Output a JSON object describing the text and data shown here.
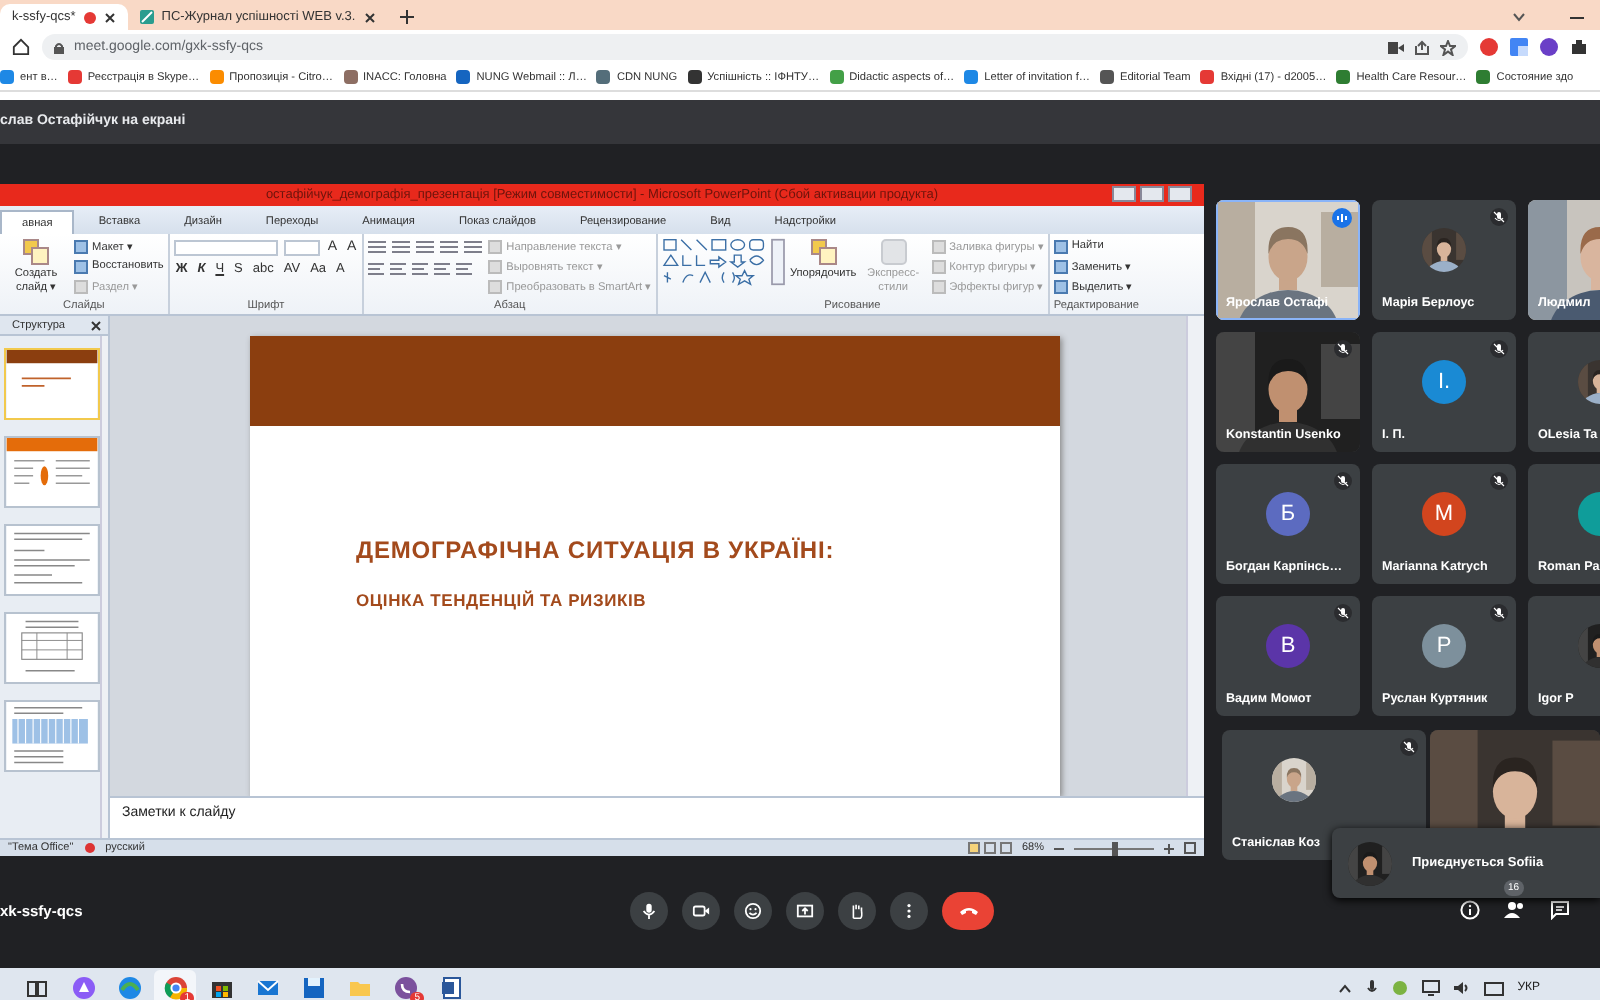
{
  "browser": {
    "tabs": [
      {
        "title": "k-ssfy-qcs*",
        "selected": true,
        "recording": true
      },
      {
        "title": "ПС-Журнал успішності WEB v.3.",
        "selected": false,
        "recording": false
      }
    ],
    "url": "meet.google.com/gxk-ssfy-qcs",
    "bookmarks": [
      "ент в…",
      "Реєстрація в Skype…",
      "Пропозиція - Citro…",
      "INACC: Головна",
      "NUNG Webmail :: Л…",
      "CDN NUNG",
      "Успішність :: ІФНТУ…",
      "Didactic aspects of…",
      "Letter of invitation f…",
      "Editorial Team",
      "Вхідні (17) - d2005…",
      "Health Care Resour…",
      "Состояние здо"
    ]
  },
  "meet": {
    "banner": "слав Остафійчук на екрані",
    "powerpoint": {
      "title": "остафійчук_демографія_презентація [Режим совместимости] - Microsoft PowerPoint (Сбой активации продукта)",
      "tabs": [
        {
          "label": "авная",
          "selected": true
        },
        {
          "label": "Вставка",
          "selected": false
        },
        {
          "label": "Дизайн",
          "selected": false
        },
        {
          "label": "Переходы",
          "selected": false
        },
        {
          "label": "Анимация",
          "selected": false
        },
        {
          "label": "Показ слайдов",
          "selected": false
        },
        {
          "label": "Рецензирование",
          "selected": false
        },
        {
          "label": "Вид",
          "selected": false
        },
        {
          "label": "Надстройки",
          "selected": false
        }
      ],
      "ribbon": [
        {
          "label": "Слайды",
          "items": [
            {
              "kind": "large",
              "label": "Создать слайд ▾",
              "disabled": false
            },
            {
              "kind": "small",
              "label": "Макет ▾",
              "disabled": false
            },
            {
              "kind": "small",
              "label": "Восстановить",
              "disabled": false
            },
            {
              "kind": "small",
              "label": "Раздел ▾",
              "disabled": true
            }
          ]
        },
        {
          "label": "Шрифт",
          "items": [
            {
              "kind": "font-tools",
              "glyphs_top": [
                "A",
                "A"
              ],
              "glyphs": [
                "Ж",
                "К",
                "Ч",
                "S",
                "abc",
                "AV",
                "Aa",
                "A"
              ]
            }
          ]
        },
        {
          "label": "Абзац",
          "items": [
            {
              "kind": "paragraph-tools"
            },
            {
              "kind": "small",
              "label": "Направление текста ▾",
              "disabled": true
            },
            {
              "kind": "small",
              "label": "Выровнять текст ▾",
              "disabled": true
            },
            {
              "kind": "small",
              "label": "Преобразовать в SmartArt ▾",
              "disabled": true
            }
          ]
        },
        {
          "label": "Рисование",
          "items": [
            {
              "kind": "shapes"
            },
            {
              "kind": "large",
              "label": "Упорядочить",
              "disabled": false
            },
            {
              "kind": "large",
              "label": "Экспресс-стили",
              "disabled": true
            },
            {
              "kind": "small",
              "label": "Заливка фигуры ▾",
              "disabled": true
            },
            {
              "kind": "small",
              "label": "Контур фигуры ▾",
              "disabled": true
            },
            {
              "kind": "small",
              "label": "Эффекты фигур ▾",
              "disabled": true
            }
          ]
        },
        {
          "label": "Редактирование",
          "items": [
            {
              "kind": "small",
              "label": "Найти",
              "disabled": false
            },
            {
              "kind": "small",
              "label": "Заменить ▾",
              "disabled": false
            },
            {
              "kind": "small",
              "label": "Выделить ▾",
              "disabled": false
            }
          ]
        }
      ],
      "outline_tab": "Структура",
      "thumbnails": [
        {
          "kind": "title",
          "selected": true
        },
        {
          "kind": "bullets",
          "selected": false
        },
        {
          "kind": "text",
          "selected": false
        },
        {
          "kind": "table",
          "selected": false
        },
        {
          "kind": "chart",
          "selected": false
        }
      ],
      "slide": {
        "title": "ДЕМОГРАФІЧНА СИТУАЦІЯ В УКРАЇНІ:",
        "subtitle": "ОЦІНКА ТЕНДЕНЦІЙ ТА РИЗИКІВ"
      },
      "notes": {
        "placeholder": "Заметки к слайду"
      },
      "status": {
        "theme": "\"Тема Office\"",
        "language": "русский",
        "zoom": "68%",
        "level": 0.5
      }
    },
    "participants": [
      {
        "name": "Ярослав Остафі",
        "kind": "video",
        "speaking": true,
        "muted": false
      },
      {
        "name": "Марія Берлоус",
        "speaking": false,
        "muted": true
      },
      {
        "name": "Людмил",
        "kind": "video",
        "speaking": false
      },
      {
        "name": "Konstantin Usenko",
        "kind": "video",
        "speaking": false,
        "muted": true
      },
      {
        "name": "І. П.",
        "kind": "letter",
        "initial": "І.",
        "color": "#1a8ad4",
        "speaking": false,
        "muted": true
      },
      {
        "name": "OLesia Ta",
        "speaking": false
      },
      {
        "name": "Богдан Карпінсь…",
        "kind": "letter",
        "initial": "Б",
        "color": "#5c6bc0",
        "speaking": false,
        "muted": true
      },
      {
        "name": "Marianna Katrych",
        "kind": "letter",
        "initial": "M",
        "color": "#d2451e",
        "speaking": false,
        "muted": true
      },
      {
        "name": "Roman Pa",
        "kind": "letter",
        "color": "#0f9d9a",
        "speaking": false
      },
      {
        "name": "Вадим Момот",
        "kind": "letter",
        "initial": "В",
        "color": "#5b35a8",
        "speaking": false,
        "muted": true
      },
      {
        "name": "Руслан Куртяник",
        "kind": "letter",
        "initial": "Р",
        "color": "#7d909c",
        "speaking": false,
        "muted": true
      },
      {
        "name": "Igor P",
        "speaking": false
      },
      {
        "name": "Станіслав Коз",
        "speaking": false,
        "muted": true
      },
      {
        "kind": "video",
        "speaking": false,
        "muted": false
      }
    ],
    "toast": "Приєднується Sofiia",
    "meeting_code": "xk-ssfy-qcs",
    "participant_count": "16"
  },
  "taskbar": {
    "apps": [
      {
        "kind": "task-view",
        "active": false
      },
      {
        "kind": "assistant",
        "active": false
      },
      {
        "kind": "edge",
        "active": false
      },
      {
        "kind": "chrome",
        "active": true,
        "badge": "1"
      },
      {
        "kind": "store",
        "active": false
      },
      {
        "kind": "mail",
        "active": false
      },
      {
        "kind": "disk",
        "active": false
      },
      {
        "kind": "folder",
        "active": false
      },
      {
        "kind": "viber",
        "active": false,
        "badge": "5"
      },
      {
        "kind": "document",
        "active": false
      }
    ],
    "language": "УКР"
  }
}
